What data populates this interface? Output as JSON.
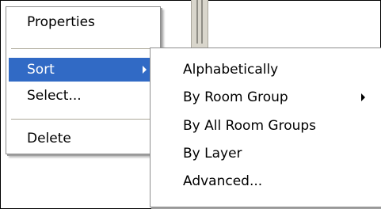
{
  "context_menu": {
    "items": [
      {
        "label": "Properties"
      },
      {
        "label": "Sort"
      },
      {
        "label": "Select..."
      },
      {
        "label": "Delete"
      }
    ]
  },
  "sort_submenu": {
    "items": [
      {
        "label": "Alphabetically"
      },
      {
        "label": "By Room Group"
      },
      {
        "label": "By All Room Groups"
      },
      {
        "label": "By Layer"
      },
      {
        "label": "Advanced..."
      }
    ]
  },
  "colors": {
    "highlight": "#316ac5",
    "separator": "#aca899",
    "menu_background": "#ffffff"
  }
}
